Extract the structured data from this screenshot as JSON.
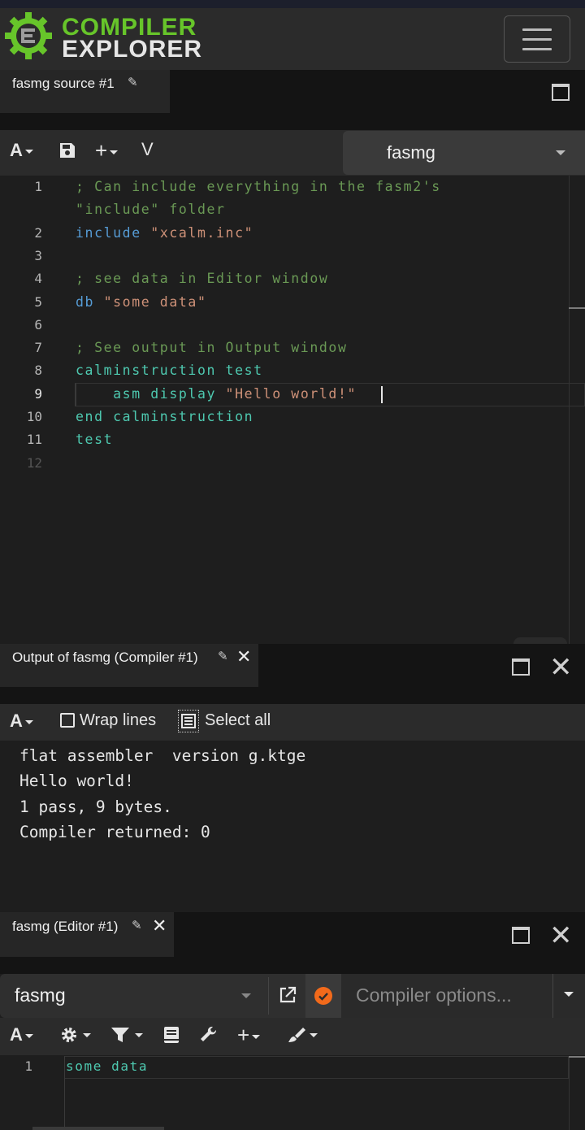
{
  "header": {
    "logo_line1": "COMPILER",
    "logo_line2": "EXPLORER"
  },
  "source_pane": {
    "tab_title": "fasmg source #1",
    "language": "fasmg",
    "toolbar": {
      "font_label": "A",
      "add_label": "+",
      "vim_label": "V"
    },
    "lines": [
      {
        "num": "1",
        "segments": [
          {
            "t": "; Can include everything in the fasm2's",
            "c": "com"
          }
        ]
      },
      {
        "num": "",
        "segments": [
          {
            "t": "\"include\" folder",
            "c": "com"
          }
        ]
      },
      {
        "num": "2",
        "segments": [
          {
            "t": "include ",
            "c": "kw"
          },
          {
            "t": "\"xcalm.inc\"",
            "c": "str"
          }
        ]
      },
      {
        "num": "3",
        "segments": []
      },
      {
        "num": "4",
        "segments": [
          {
            "t": "; see data in Editor window",
            "c": "com"
          }
        ]
      },
      {
        "num": "5",
        "segments": [
          {
            "t": "db ",
            "c": "kw"
          },
          {
            "t": "\"some data\"",
            "c": "str"
          }
        ]
      },
      {
        "num": "6",
        "segments": []
      },
      {
        "num": "7",
        "segments": [
          {
            "t": "; See output in Output window",
            "c": "com"
          }
        ]
      },
      {
        "num": "8",
        "segments": [
          {
            "t": "calminstruction test",
            "c": "id"
          }
        ]
      },
      {
        "num": "9",
        "segments": [
          {
            "t": "    asm display ",
            "c": "id"
          },
          {
            "t": "\"Hello world!\"",
            "c": "str"
          }
        ]
      },
      {
        "num": "10",
        "segments": [
          {
            "t": "end calminstruction",
            "c": "id"
          }
        ]
      },
      {
        "num": "11",
        "segments": [
          {
            "t": "test",
            "c": "id"
          }
        ]
      },
      {
        "num": "12",
        "segments": []
      }
    ]
  },
  "output_pane": {
    "tab_title": "Output of fasmg (Compiler #1)",
    "toolbar": {
      "font_label": "A",
      "wrap_label": "Wrap lines",
      "select_all_label": "Select all"
    },
    "lines": [
      "flat assembler  version g.ktge",
      "Hello world!",
      "1 pass, 9 bytes.",
      "Compiler returned: 0"
    ]
  },
  "compiler_pane": {
    "tab_title": "fasmg (Editor #1)",
    "compiler": "fasmg",
    "options_placeholder": "Compiler options...",
    "status_color": "#f26a1b",
    "toolbar": {
      "font_label": "A",
      "add_label": "+"
    },
    "lines": [
      {
        "num": "1",
        "text": "some data"
      }
    ]
  },
  "colors": {
    "brand_green": "#67c52a",
    "comment": "#6a9955",
    "keyword": "#569cd6",
    "string": "#ce9178",
    "identifier": "#4ec9b0"
  }
}
